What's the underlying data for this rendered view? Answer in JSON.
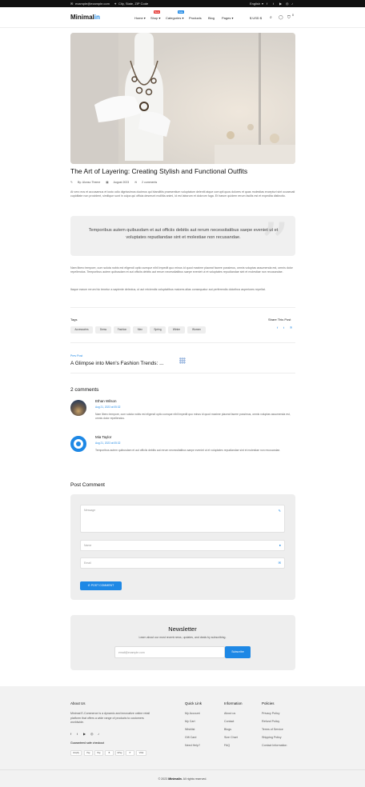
{
  "topbar": {
    "email": "example@example.com",
    "address": "City, State, ZIP Code",
    "language": "English"
  },
  "nav": {
    "logo_main": "Minimal",
    "logo_accent": "in",
    "items": [
      "Home",
      "Shop",
      "Categories",
      "Products",
      "Blog",
      "Pages"
    ],
    "badge_shop": "New",
    "badge_categories": "Sale",
    "currency": "$ USD $",
    "cart_count": "0"
  },
  "post": {
    "title": "The Art of Layering: Creating Stylish and Functional Outfits",
    "author": "By: Alonso Theme",
    "date": "August 2023",
    "comments": "2 comments",
    "intro": "At vero eos et accusamus et iusto odio dignissimos ducimus qui blanditiis praesentium voluptatum deleniti atque corrupti quos dolores et quas molestias excepturi sint occaecati cupiditate non provident, similique sunt in culpa qui officia deserunt mollitia animi, id est laborum et dolorum fuga. Et harum quidem rerum facilis est et expedita distinctio.",
    "quote": "Temporibus autem quibusdam et aut officiis debitis aut rerum necessitatibus saepe eveniet ut et voluptates repudiandae sint et molestiae non recusandae.",
    "body1": "Nam libero tempore, cum soluta nobis est eligendi optio cumque nihil impedit quo minus id quod maxime placeat facere possimus, omnis voluptas assumenda est, omnis dolor repellendus. Temporibus autem quibusdam et aut officiis debitis aut rerum necessitatibus saepe eveniet ut et voluptates repudiandae sint et molestiae non recusandae.",
    "body2": "Itaque earum rerum hic tenetur a sapiente delectus, ut aut reiciendis voluptatibus maiores alias consequatur aut perferendis doloribus asperiores repellat.",
    "tags_label": "Tags",
    "tags": [
      "Accessories",
      "Dress",
      "Fashion",
      "Men",
      "Spring",
      "Winter",
      "Women"
    ],
    "share_label": "Share This Post",
    "prev_label": "Prev Post",
    "prev_title": "A Glimpse into Men's Fashion Trends: ..."
  },
  "comments": {
    "heading": "2 comments",
    "list": [
      {
        "name": "Ethan Wilson",
        "date": "Aug 21, 2023 at 05:32",
        "text": "Nam libero tempore, cum soluta nobis est eligendi optio cumque nihil impedit quo minus id quod maxime placeat facere possimus, omnis voluptas assumenda est, omnis dolor repellendus."
      },
      {
        "name": "Mia Taylor",
        "date": "Aug 21, 2023 at 05:32",
        "text": "Temporibus autem quibusdam et aut officiis debitis aut rerum necessitatibus saepe eveniet ut et voluptates repudiandae sint et molestiae non recusandae."
      }
    ]
  },
  "post_comment": {
    "heading": "Post Comment",
    "message_placeholder": "Message",
    "name_placeholder": "Name",
    "email_placeholder": "Email",
    "submit": "POST COMMENT"
  },
  "newsletter": {
    "heading": "Newsletter",
    "subtext": "Learn about our most recent news, updates, and deals by subscribing.",
    "placeholder": "email@example.com",
    "button": "Subscribe"
  },
  "footer": {
    "about_heading": "About Us",
    "about_text": "Minimal E-Commerce is a dynamic and innovative online retail platform that offers a wide range of products to customers worldwide.",
    "checkout_label": "Guaranteed safe checkout",
    "payments": [
      "shopify",
      "Pay",
      "Pay",
      "B",
      "GPay",
      "P",
      "VISA"
    ],
    "quick_heading": "Quick Link",
    "quick_links": [
      "My Account",
      "My Cart",
      "Wishlist",
      "Gift Card",
      "Need Help?"
    ],
    "info_heading": "Information",
    "info_links": [
      "About us",
      "Contact",
      "Blogs",
      "Size Chart",
      "FAQ"
    ],
    "policies_heading": "Policies",
    "policy_links": [
      "Privacy Policy",
      "Refund Policy",
      "Terms of Service",
      "Shipping Policy",
      "Contact Information"
    ],
    "copyright_pre": "© 2023",
    "copyright_brand": "Minimalin",
    "copyright_post": ". All rights reserved."
  }
}
